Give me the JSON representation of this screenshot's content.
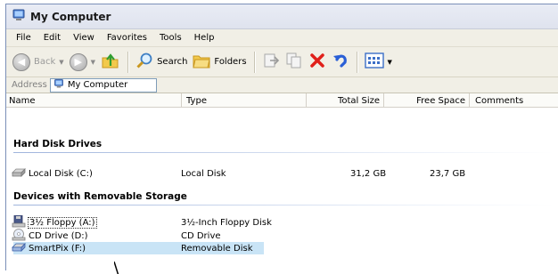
{
  "window": {
    "title": "My Computer"
  },
  "menu": [
    "File",
    "Edit",
    "View",
    "Favorites",
    "Tools",
    "Help"
  ],
  "toolbar": {
    "back_label": "Back",
    "search_label": "Search",
    "folders_label": "Folders",
    "icons": [
      "back-arrow-icon",
      "forward-arrow-icon",
      "up-folder-icon",
      "search-magnifier-icon",
      "folders-icon",
      "move-to-icon",
      "copy-to-icon",
      "delete-x-icon",
      "undo-icon",
      "views-icon"
    ]
  },
  "address": {
    "label": "Address",
    "value": "My Computer"
  },
  "columns": [
    "Name",
    "Type",
    "Total Size",
    "Free Space",
    "Comments"
  ],
  "groups": [
    {
      "title": "Hard Disk Drives"
    },
    {
      "title": "Devices with Removable Storage"
    }
  ],
  "drives": {
    "hdd": [
      {
        "name": "Local Disk (C:)",
        "type": "Local Disk",
        "total": "31,2 GB",
        "free": "23,7 GB"
      }
    ],
    "removable": [
      {
        "name": "3½ Floppy (A:)",
        "type": "3½-Inch Floppy Disk"
      },
      {
        "name": "CD Drive (D:)",
        "type": "CD Drive"
      },
      {
        "name": "SmartPix (F:)",
        "type": "Removable Disk"
      }
    ]
  },
  "colors": {
    "accent_red": "#e0201a",
    "selection": "#c9e4f6",
    "undo_blue": "#2a5fd6"
  }
}
